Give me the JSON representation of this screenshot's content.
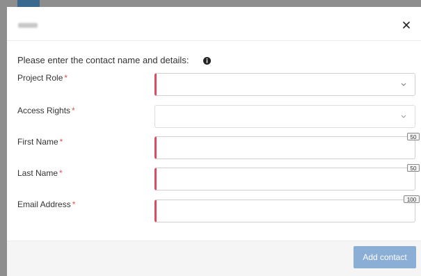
{
  "modal": {
    "intro_text": "Please enter the contact name and details:",
    "info_icon": "info-circle-icon",
    "close_icon": "close-icon"
  },
  "form": {
    "required_marker": "*",
    "fields": [
      {
        "label": "Project Role",
        "type": "select",
        "value": "",
        "required_indicator": true
      },
      {
        "label": "Access Rights",
        "type": "select",
        "value": "",
        "required_indicator": false
      },
      {
        "label": "First Name",
        "type": "text",
        "value": "",
        "max_length": "50",
        "required_indicator": true
      },
      {
        "label": "Last Name",
        "type": "text",
        "value": "",
        "max_length": "50",
        "required_indicator": true
      },
      {
        "label": "Email Address",
        "type": "text",
        "value": "",
        "max_length": "100",
        "required_indicator": true
      }
    ]
  },
  "footer": {
    "add_contact_label": "Add contact"
  },
  "colors": {
    "accent": "#39698f",
    "required_border": "#de4a5f",
    "required_star": "#d9534f",
    "button_disabled": "#8aaed5"
  }
}
